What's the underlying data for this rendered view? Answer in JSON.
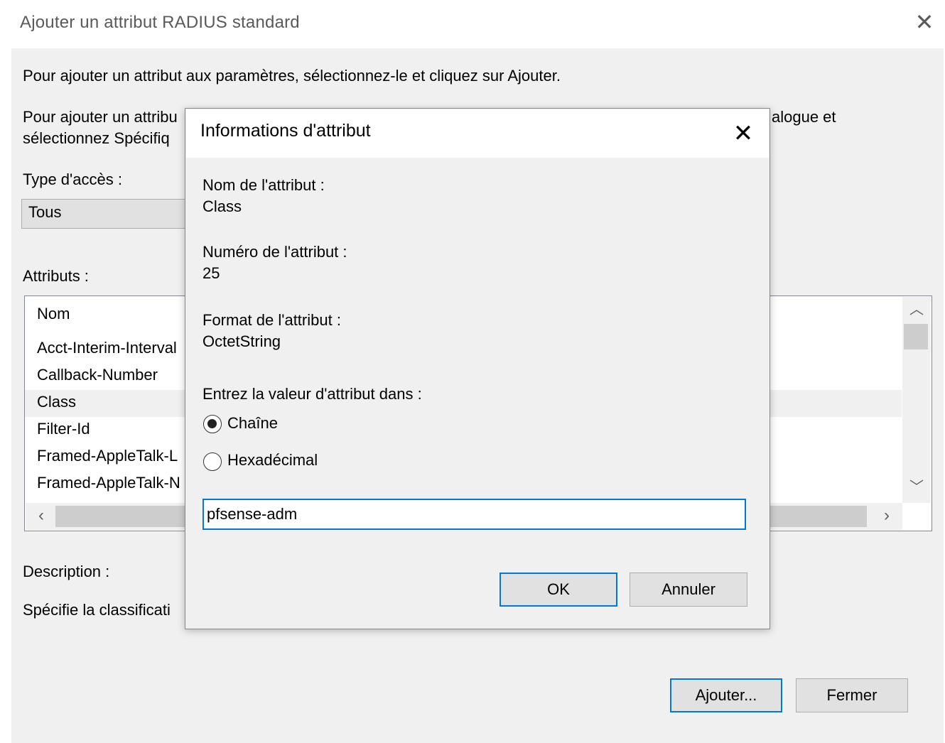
{
  "outer_dialog": {
    "title": "Ajouter un attribut RADIUS standard",
    "intro_line1": "Pour ajouter un attribut aux paramètres, sélectionnez-le et cliquez sur Ajouter.",
    "intro_line2_start": "Pour ajouter un attribu",
    "intro_line2_end": "alogue et",
    "intro_line3_start": "sélectionnez Spécifiq",
    "access_type_label": "Type d'accès :",
    "access_type_value": "Tous",
    "attributes_label": "Attributs :",
    "list_header": "Nom",
    "list_items": [
      {
        "label": "Acct-Interim-Interval"
      },
      {
        "label": "Callback-Number"
      },
      {
        "label": "Class"
      },
      {
        "label": "Filter-Id"
      },
      {
        "label": "Framed-AppleTalk-L"
      },
      {
        "label": "Framed-AppleTalk-N"
      }
    ],
    "selected_index": 2,
    "description_label": "Description :",
    "description_text": "Spécifie la classificati",
    "add_button": "Ajouter...",
    "close_button": "Fermer"
  },
  "inner_dialog": {
    "title": "Informations d'attribut",
    "name_label": "Nom de l'attribut :",
    "name_value": "Class",
    "number_label": "Numéro de l'attribut :",
    "number_value": "25",
    "format_label": "Format de l'attribut :",
    "format_value": "OctetString",
    "enter_label": "Entrez la valeur d'attribut dans :",
    "radio_string": "Chaîne",
    "radio_hex": "Hexadécimal",
    "selected_radio": "Chaîne",
    "value": "pfsense-adm",
    "ok_button": "OK",
    "cancel_button": "Annuler"
  },
  "icons": {
    "close": "close-icon",
    "scroll_up": "chevron-up-icon",
    "scroll_down": "chevron-down-icon",
    "scroll_left": "chevron-left-icon",
    "scroll_right": "chevron-right-icon"
  },
  "colors": {
    "accent": "#0078d7",
    "dialog_bg": "#f0f0f0",
    "selection": "#f0f0f0"
  }
}
